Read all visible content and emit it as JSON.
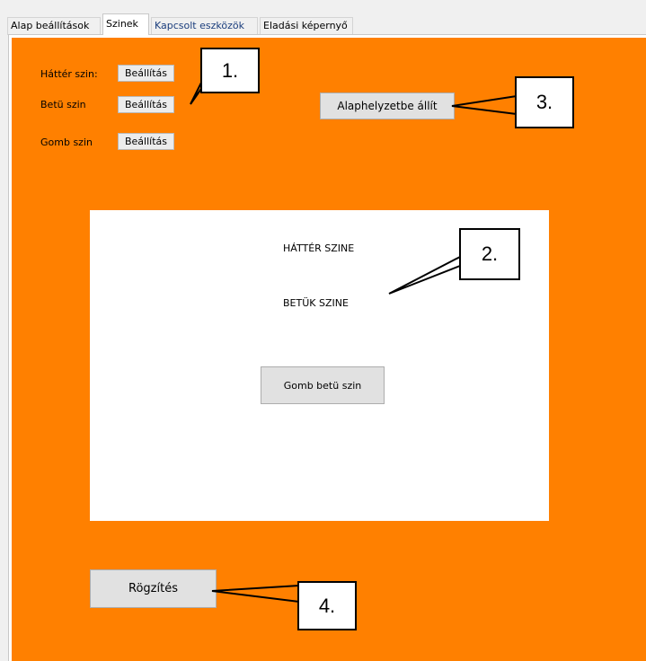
{
  "tabs": [
    {
      "label": "Alap beállítások"
    },
    {
      "label": "Szinek"
    },
    {
      "label": "Kapcsolt eszközök"
    },
    {
      "label": "Eladási képernyő"
    }
  ],
  "colors": {
    "panel_background": "#ff8000",
    "preview_background": "#ffffff"
  },
  "settings": {
    "background_label": "Háttér szin:",
    "text_label": "Betü szin",
    "button_label": "Gomb szin",
    "set_button": "Beállítás"
  },
  "reset_button": "Alaphelyzetbe állít",
  "preview": {
    "background_text": "HÁTTÉR SZINE",
    "letters_text": "BETÜK SZINE",
    "button_text": "Gomb betü szin"
  },
  "save_button": "Rögzítés",
  "callouts": [
    "1.",
    "2.",
    "3.",
    "4."
  ]
}
